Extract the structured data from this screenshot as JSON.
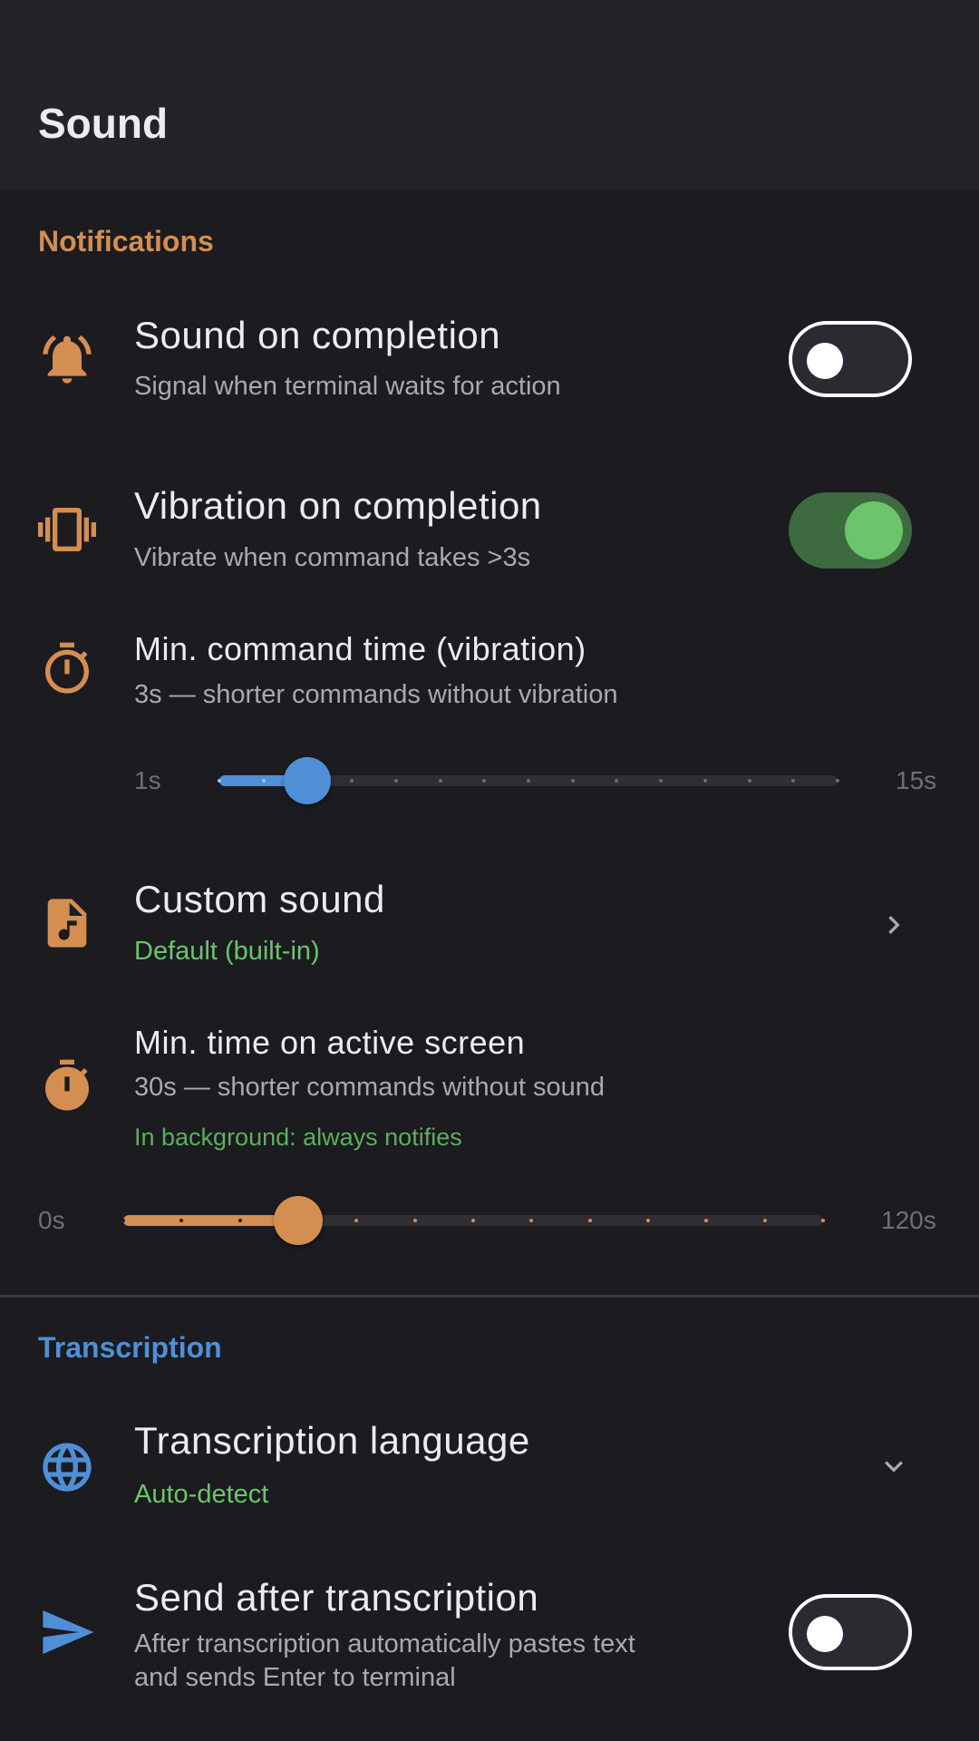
{
  "header": {
    "title": "Sound"
  },
  "notifications": {
    "section_label": "Notifications",
    "sound_on_completion": {
      "title": "Sound on completion",
      "subtitle": "Signal when terminal waits for action",
      "enabled": false
    },
    "vibration_on_completion": {
      "title": "Vibration on completion",
      "subtitle": "Vibrate when command takes >3s",
      "enabled": true
    },
    "min_command_time": {
      "title": "Min. command time (vibration)",
      "subtitle": "3s — shorter commands without vibration",
      "slider": {
        "min_label": "1s",
        "max_label": "15s",
        "min": 1,
        "max": 15,
        "value": 3
      }
    },
    "custom_sound": {
      "title": "Custom sound",
      "value": "Default (built-in)"
    },
    "min_time_active_screen": {
      "title": "Min. time on active screen",
      "subtitle": "30s — shorter commands without sound",
      "note": "In background: always notifies",
      "slider": {
        "min_label": "0s",
        "max_label": "120s",
        "min": 0,
        "max": 120,
        "value": 30
      }
    }
  },
  "transcription": {
    "section_label": "Transcription",
    "language": {
      "title": "Transcription language",
      "value": "Auto-detect"
    },
    "send_after": {
      "title": "Send after transcription",
      "subtitle_line1": "After transcription automatically pastes text",
      "subtitle_line2": "and sends Enter to terminal",
      "enabled": false
    }
  },
  "colors": {
    "accent_orange": "#d48e52",
    "accent_blue": "#4f8fd6",
    "accent_green": "#6cc56a",
    "background": "#1b1b20",
    "header_bg": "#232328"
  },
  "icons": {
    "sound_on_completion": "bell-icon",
    "vibration_on_completion": "vibration-icon",
    "min_command_time": "timer-icon",
    "custom_sound": "audio-file-icon",
    "min_time_active_screen": "stopwatch-icon",
    "language": "globe-icon",
    "send_after": "send-icon",
    "custom_sound_nav": "chevron-right-icon",
    "language_nav": "chevron-down-icon"
  }
}
